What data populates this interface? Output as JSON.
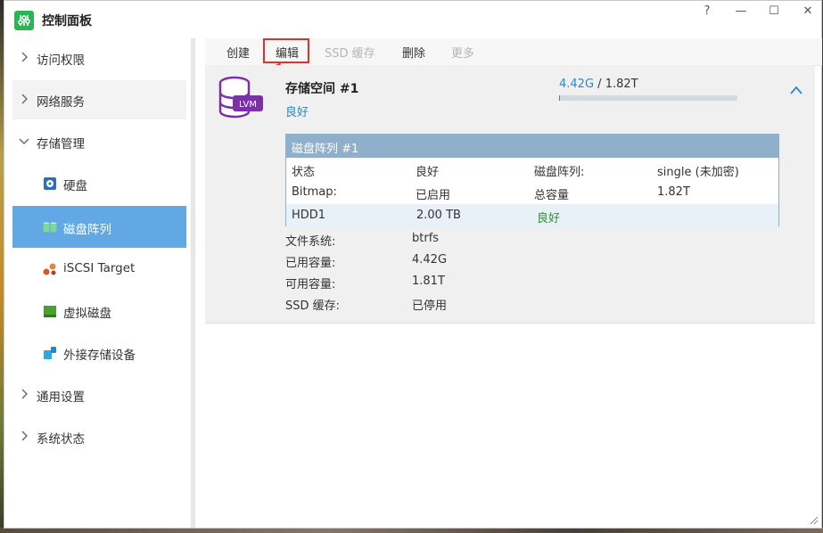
{
  "window": {
    "title": "控制面板",
    "help": "?",
    "minimize": "—",
    "maximize": "☐",
    "close": "✕"
  },
  "sidebar": {
    "items": [
      {
        "label": "访问权限"
      },
      {
        "label": "网络服务"
      },
      {
        "label": "存储管理"
      },
      {
        "label": "硬盘"
      },
      {
        "label": "磁盘阵列"
      },
      {
        "label": "iSCSI Target"
      },
      {
        "label": "虚拟磁盘"
      },
      {
        "label": "外接存储设备"
      },
      {
        "label": "通用设置"
      },
      {
        "label": "系统状态"
      }
    ]
  },
  "toolbar": {
    "create": "创建",
    "edit": "编辑",
    "ssd_cache": "SSD 缓存",
    "delete": "删除",
    "more": "更多"
  },
  "pool": {
    "badge": "LVM",
    "name": "存储空间 #1",
    "status": "良好",
    "used": "4.42G",
    "separator": " / ",
    "total": "1.82T",
    "used_fraction": 0.0024
  },
  "array": {
    "title": "磁盘阵列 #1",
    "rows": [
      [
        "状态",
        "良好",
        "磁盘阵列:",
        "single (未加密)"
      ],
      [
        "Bitmap:",
        "已启用",
        "总容量",
        "1.82T"
      ]
    ],
    "disk": {
      "name": "HDD1",
      "size": "2.00 TB",
      "status": "良好"
    }
  },
  "info": [
    {
      "label": "文件系统:",
      "value": "btrfs"
    },
    {
      "label": "已用容量:",
      "value": "4.42G"
    },
    {
      "label": "可用容量:",
      "value": "1.81T"
    },
    {
      "label": "SSD 缓存:",
      "value": "已停用"
    }
  ],
  "colors": {
    "accent": "#2b88c9",
    "active": "#62a8e5",
    "good": "#2f8f2f",
    "highlight": "#e0302a",
    "brand": "#2ab455",
    "lvm": "#7b2fa8"
  }
}
